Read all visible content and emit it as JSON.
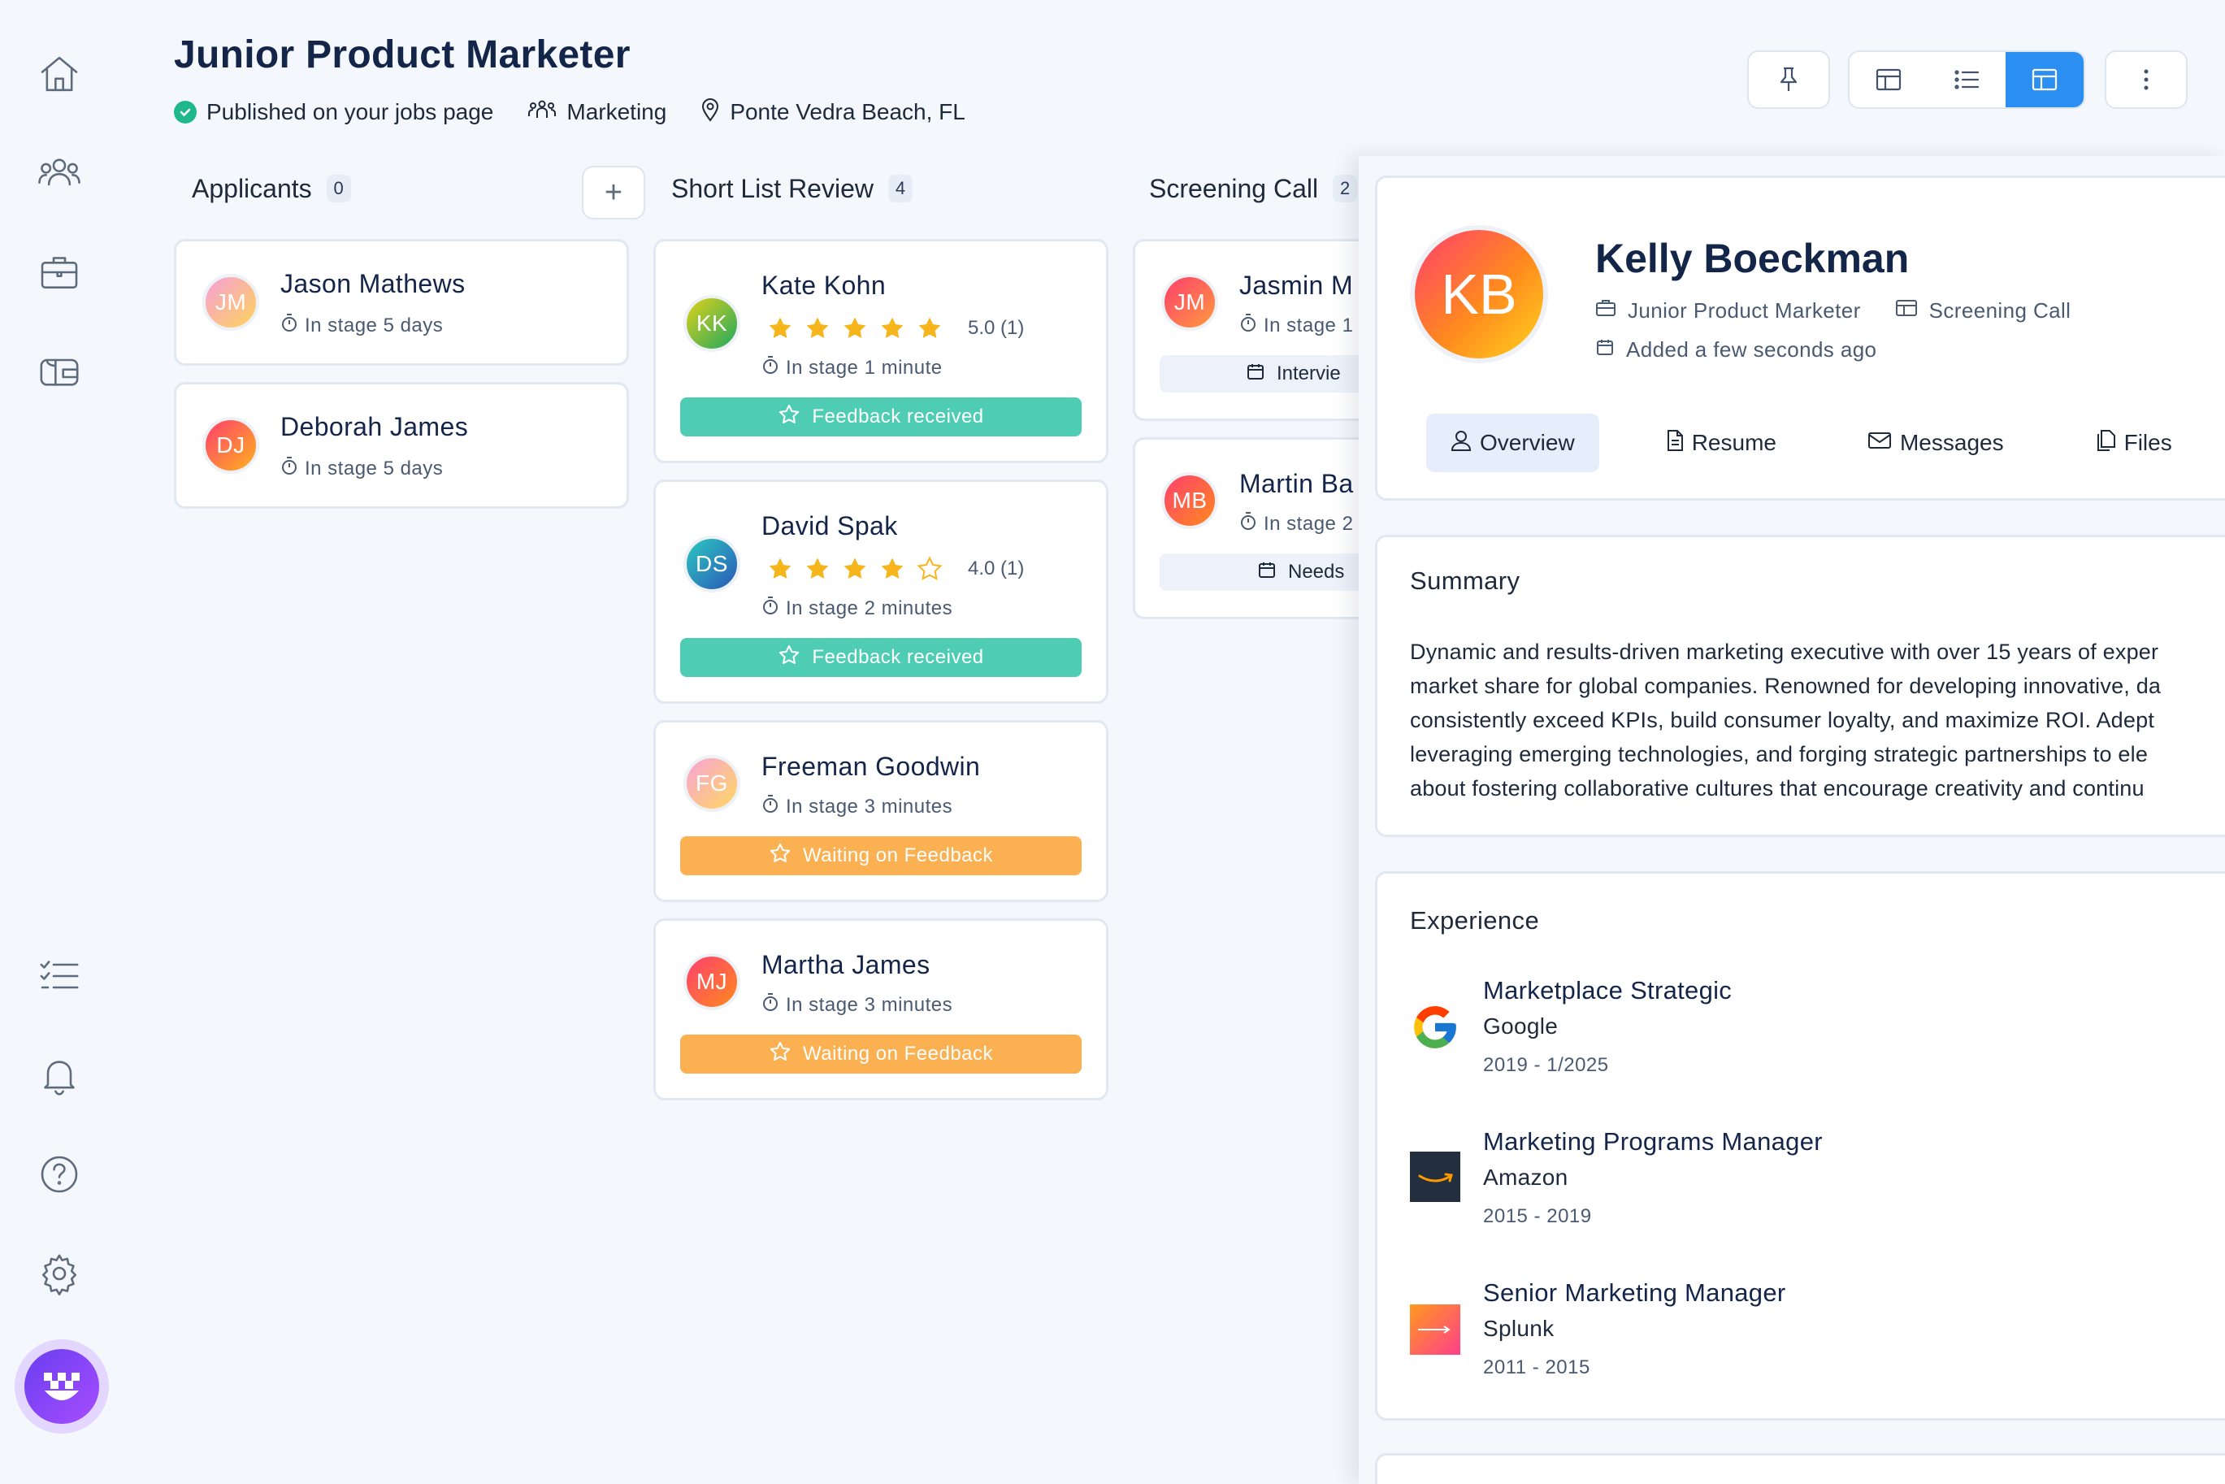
{
  "header": {
    "title": "Junior Product Marketer",
    "status": "Published on your jobs page",
    "department": "Marketing",
    "location": "Ponte Vedra Beach, FL"
  },
  "sidebar": {
    "top_icons": [
      "home-icon",
      "people-icon",
      "briefcase-icon",
      "wallet-icon"
    ],
    "bottom_icons": [
      "checklist-icon",
      "bell-icon",
      "help-icon",
      "gear-icon"
    ]
  },
  "columns": [
    {
      "title": "Applicants",
      "count": "0"
    },
    {
      "title": "Short List Review",
      "count": "4"
    },
    {
      "title": "Screening Call",
      "count": "2"
    }
  ],
  "applicants": [
    {
      "initials": "JM",
      "name": "Jason Mathews",
      "stage": "In stage 5 days"
    },
    {
      "initials": "DJ",
      "name": "Deborah James",
      "stage": "In stage 5 days"
    }
  ],
  "shortlist": [
    {
      "initials": "KK",
      "name": "Kate Kohn",
      "stage": "In stage 1 minute",
      "rating": 5,
      "rating_label": "5.0 (1)",
      "badge": "Feedback received"
    },
    {
      "initials": "DS",
      "name": "David Spak",
      "stage": "In stage 2 minutes",
      "rating": 4,
      "rating_label": "4.0 (1)",
      "badge": "Feedback received"
    },
    {
      "initials": "FG",
      "name": "Freeman Goodwin",
      "stage": "In stage 3 minutes",
      "badge": "Waiting on Feedback"
    },
    {
      "initials": "MJ",
      "name": "Martha James",
      "stage": "In stage 3 minutes",
      "badge": "Waiting on Feedback"
    }
  ],
  "screening": [
    {
      "initials": "JM",
      "name": "Jasmin M",
      "stage": "In stage 1",
      "chip": "Intervie"
    },
    {
      "initials": "MB",
      "name": "Martin Ba",
      "stage": "In stage 2",
      "chip": "Needs"
    }
  ],
  "profile": {
    "initials": "KB",
    "name": "Kelly Boeckman",
    "job": "Junior Product Marketer",
    "stage": "Screening Call",
    "added": "Added a few seconds ago",
    "tabs": [
      "Overview",
      "Resume",
      "Messages",
      "Files"
    ],
    "summary_title": "Summary",
    "summary_lines": [
      "Dynamic and results-driven marketing executive with over 15 years of exper",
      "market share for global companies. Renowned for developing innovative, da",
      "consistently exceed KPIs, build consumer loyalty, and maximize ROI. Adept",
      "leveraging emerging technologies, and forging strategic partnerships to ele",
      "about fostering collaborative cultures that encourage creativity and continu"
    ],
    "experience_title": "Experience",
    "experience": [
      {
        "role": "Marketplace Strategic",
        "company": "Google",
        "dates": "2019 - 1/2025",
        "logo": "google-logo"
      },
      {
        "role": "Marketing Programs Manager",
        "company": "Amazon",
        "dates": "2015 - 2019",
        "logo": "amazon-logo"
      },
      {
        "role": "Senior Marketing Manager",
        "company": "Splunk",
        "dates": "2011 - 2015",
        "logo": "splunk-logo"
      }
    ]
  },
  "colors": {
    "accent": "#2b8ff2",
    "feedback_received": "#4ecdb4",
    "waiting_feedback": "#fbb052",
    "star": "#f7b51c"
  }
}
